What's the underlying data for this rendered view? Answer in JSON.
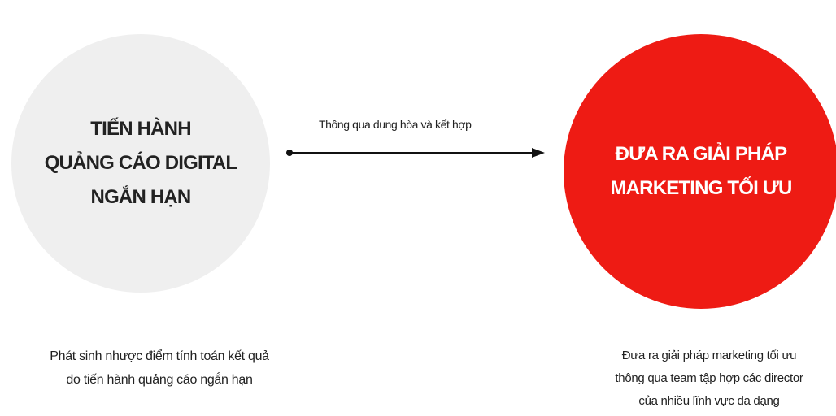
{
  "left_circle": {
    "lines": [
      "TIẾN HÀNH",
      "QUẢNG CÁO DIGITAL",
      "NGẮN HẠN"
    ],
    "color": "#efefef"
  },
  "right_circle": {
    "lines": [
      "ĐƯA RA GIẢI PHÁP",
      "MARKETING TỐI ƯU"
    ],
    "color": "#ee1b14"
  },
  "connector": {
    "label": "Thông qua dung hòa và kết hợp"
  },
  "left_caption": {
    "lines": [
      "Phát sinh nhược điểm tính toán kết quả",
      "do tiến hành quảng cáo ngắn hạn"
    ]
  },
  "right_caption": {
    "lines": [
      "Đưa ra giải pháp marketing tối ưu",
      "thông qua team tập hợp các director",
      "của nhiều lĩnh vực đa dạng"
    ]
  }
}
